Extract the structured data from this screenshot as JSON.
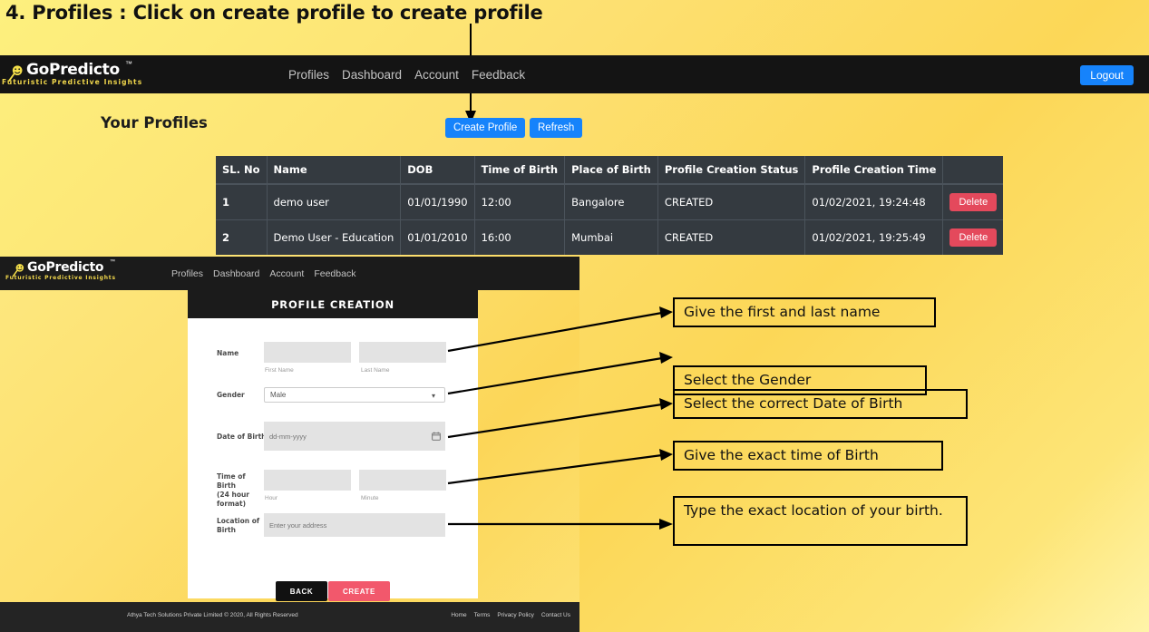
{
  "slide": {
    "title": "4. Profiles : Click on create profile to create profile"
  },
  "brand": {
    "name": "GoPredicto",
    "tm": "™",
    "tagline": "Futuristic Predictive Insights",
    "icon": "magnifier-smiley-icon"
  },
  "outer_app": {
    "nav_links": [
      "Profiles",
      "Dashboard",
      "Account",
      "Feedback"
    ],
    "logout_label": "Logout",
    "heading": "Your Profiles",
    "buttons": {
      "create_profile": "Create Profile",
      "refresh": "Refresh"
    },
    "table": {
      "headers": [
        "SL. No",
        "Name",
        "DOB",
        "Time of Birth",
        "Place of Birth",
        "Profile Creation Status",
        "Profile Creation Time",
        ""
      ],
      "rows": [
        {
          "sl_no": "1",
          "name": "demo user",
          "dob": "01/01/1990",
          "time_of_birth": "12:00",
          "place_of_birth": "Bangalore",
          "status": "CREATED",
          "creation_time": "01/02/2021, 19:24:48",
          "action": "Delete"
        },
        {
          "sl_no": "2",
          "name": "Demo User - Education",
          "dob": "01/01/2010",
          "time_of_birth": "16:00",
          "place_of_birth": "Mumbai",
          "status": "CREATED",
          "creation_time": "01/02/2021, 19:25:49",
          "action": "Delete"
        }
      ]
    }
  },
  "inner_app": {
    "nav_links": [
      "Profiles",
      "Dashboard",
      "Account",
      "Feedback"
    ],
    "form": {
      "title": "PROFILE CREATION",
      "name_label": "Name",
      "first_name_placeholder": "",
      "first_name_sublabel": "First Name",
      "last_name_placeholder": "",
      "last_name_sublabel": "Last Name",
      "gender_label": "Gender",
      "gender_value": "Male",
      "gender_options": [
        "Male"
      ],
      "dob_label": "Date of Birth",
      "dob_placeholder": "dd-mm-yyyy",
      "tob_label_line1": "Time of Birth",
      "tob_label_line2": "(24 hour format)",
      "hour_sublabel": "Hour",
      "minute_sublabel": "Minute",
      "location_label": "Location of Birth",
      "location_placeholder": "Enter your address",
      "back_label": "BACK",
      "create_label": "CREATE"
    },
    "footer": {
      "copyright": "Athya Tech Solutions Private Limited © 2020, All Rights Reserved",
      "links": [
        "Home",
        "Terms",
        "Privacy Policy",
        "Contact Us"
      ]
    }
  },
  "annotations": [
    {
      "text": "Give the first and last name"
    },
    {
      "text": "Select the Gender"
    },
    {
      "text": "Select the correct Date of Birth"
    },
    {
      "text": "Give the exact time of Birth"
    },
    {
      "text": "Type the exact location of your birth."
    }
  ],
  "colors": {
    "background_yellow": "#fcd757",
    "nav_dark": "#141414",
    "primary_blue": "#1683fb",
    "danger_red": "#e4495c",
    "create_pink": "#f2586c",
    "table_dark": "#343a40",
    "brand_yellow": "#f2d84c"
  }
}
